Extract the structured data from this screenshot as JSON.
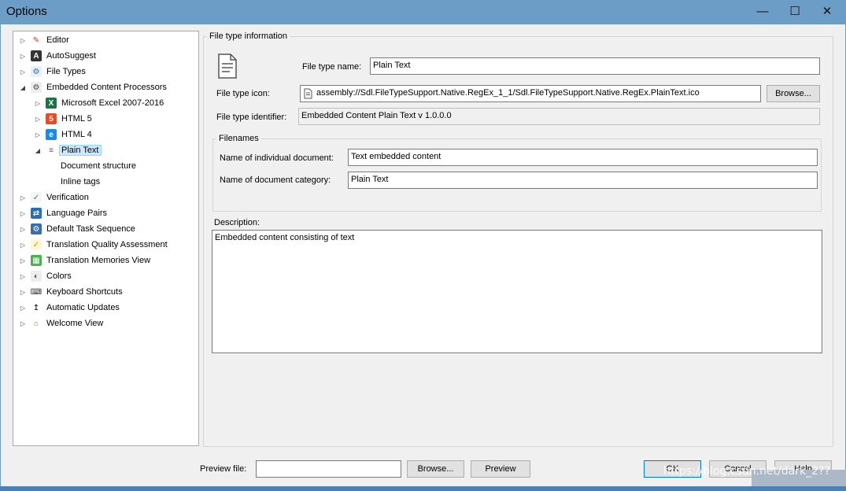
{
  "window": {
    "title": "Options",
    "min": "—",
    "max": "☐",
    "close": "✕"
  },
  "tree": [
    {
      "label": "Editor",
      "icon": "pencil-icon",
      "level": 0,
      "expander": "▷"
    },
    {
      "label": "AutoSuggest",
      "icon": "autosuggest-icon",
      "level": 0,
      "expander": "▷"
    },
    {
      "label": "File Types",
      "icon": "file-types-icon",
      "level": 0,
      "expander": "▷"
    },
    {
      "label": "Embedded Content Processors",
      "icon": "gear-icon",
      "level": 0,
      "expander": "◢"
    },
    {
      "label": "Microsoft Excel 2007-2016",
      "icon": "excel-icon",
      "level": 1,
      "expander": "▷"
    },
    {
      "label": "HTML 5",
      "icon": "html5-icon",
      "level": 1,
      "expander": "▷"
    },
    {
      "label": "HTML 4",
      "icon": "html4-icon",
      "level": 1,
      "expander": "▷"
    },
    {
      "label": "Plain Text",
      "icon": "text-file-icon",
      "level": 1,
      "expander": "◢",
      "selected": true
    },
    {
      "label": "Document structure",
      "icon": "",
      "level": 2,
      "expander": ""
    },
    {
      "label": "Inline tags",
      "icon": "",
      "level": 2,
      "expander": ""
    },
    {
      "label": "Verification",
      "icon": "verification-icon",
      "level": 0,
      "expander": "▷"
    },
    {
      "label": "Language Pairs",
      "icon": "language-pairs-icon",
      "level": 0,
      "expander": "▷"
    },
    {
      "label": "Default Task Sequence",
      "icon": "task-sequence-icon",
      "level": 0,
      "expander": "▷"
    },
    {
      "label": "Translation Quality Assessment",
      "icon": "quality-assessment-icon",
      "level": 0,
      "expander": "▷"
    },
    {
      "label": "Translation Memories View",
      "icon": "translation-memories-icon",
      "level": 0,
      "expander": "▷"
    },
    {
      "label": "Colors",
      "icon": "palette-icon",
      "level": 0,
      "expander": "▷"
    },
    {
      "label": "Keyboard Shortcuts",
      "icon": "keyboard-icon",
      "level": 0,
      "expander": "▷"
    },
    {
      "label": "Automatic Updates",
      "icon": "updates-icon",
      "level": 0,
      "expander": "▷"
    },
    {
      "label": "Welcome View",
      "icon": "home-icon",
      "level": 0,
      "expander": "▷"
    }
  ],
  "file_type_info": {
    "group_title": "File type information",
    "name_label": "File type name:",
    "name_value": "Plain Text",
    "icon_label": "File type icon:",
    "icon_value": "assembly://Sdl.FileTypeSupport.Native.RegEx_1_1/Sdl.FileTypeSupport.Native.RegEx.PlainText.ico",
    "browse_label": "Browse...",
    "identifier_label": "File type identifier:",
    "identifier_value": "Embedded Content Plain Text v 1.0.0.0"
  },
  "filenames": {
    "group_title": "Filenames",
    "individual_label": "Name of individual document:",
    "individual_value": "Text embedded content",
    "category_label": "Name of document category:",
    "category_value": "Plain Text"
  },
  "description": {
    "label": "Description:",
    "value": "Embedded content consisting of text"
  },
  "footer": {
    "preview_file_label": "Preview file:",
    "preview_file_value": "",
    "browse_label": "Browse...",
    "preview_label": "Preview",
    "ok_label": "OK",
    "cancel_label": "Cancel",
    "help_label": "Help"
  },
  "watermark": "https://blog.csdn.net/dark_2??"
}
